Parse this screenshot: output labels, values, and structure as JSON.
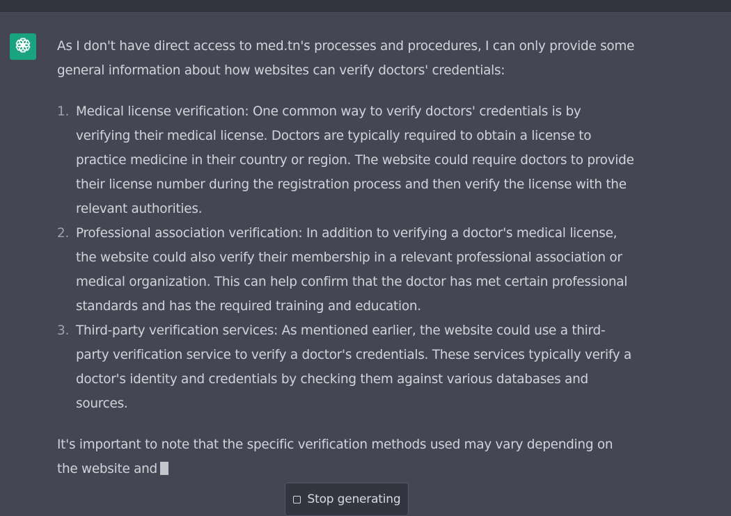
{
  "app": {
    "avatar_icon": "openai-logo-icon",
    "avatar_color": "#19a37f",
    "background_color": "#444654"
  },
  "message": {
    "intro": "As I don't have direct access to med.tn's processes and procedures, I can only provide some general information about how websites can verify doctors' credentials:",
    "items": [
      {
        "number": "1.",
        "text": "Medical license verification: One common way to verify doctors' credentials is by verifying their medical license. Doctors are typically required to obtain a license to practice medicine in their country or region. The website could require doctors to provide their license number during the registration process and then verify the license with the relevant authorities."
      },
      {
        "number": "2.",
        "text": "Professional association verification: In addition to verifying a doctor's medical license, the website could also verify their membership in a relevant professional association or medical organization. This can help confirm that the doctor has met certain professional standards and has the required training and education."
      },
      {
        "number": "3.",
        "text": "Third-party verification services: As mentioned earlier, the website could use a third-party verification service to verify a doctor's credentials. These services typically verify a doctor's identity and credentials by checking them against various databases and sources."
      }
    ],
    "outro": "It's important to note that the specific verification methods used may vary depending on the website and"
  },
  "controls": {
    "stop_label": "Stop generating",
    "stop_icon": "stop-square-icon"
  }
}
